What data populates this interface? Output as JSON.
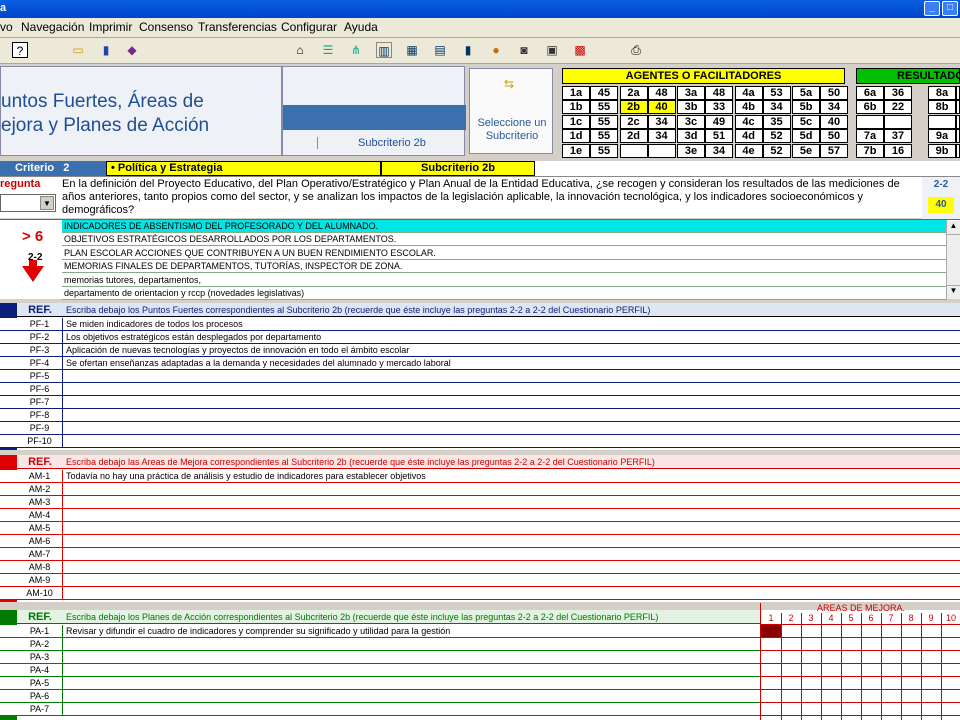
{
  "window": {
    "title": "a"
  },
  "menu": [
    "vo",
    "Navegación",
    "Imprimir",
    "Consenso",
    "Transferencias",
    "Configurar",
    "Ayuda"
  ],
  "header": {
    "title_line1": "untos Fuertes, Áreas de",
    "title_line2": "ejora y Planes de Acción",
    "subcriterio_label": "Subcriterio 2b",
    "select_hint": "Seleccione un Subcriterio"
  },
  "agentes": {
    "title": "AGENTES O FACILITADORES",
    "rows": [
      [
        [
          "1a",
          "45"
        ],
        [
          "2a",
          "48"
        ],
        [
          "3a",
          "48"
        ],
        [
          "4a",
          "53"
        ],
        [
          "5a",
          "50"
        ]
      ],
      [
        [
          "1b",
          "55"
        ],
        [
          "2b",
          "40"
        ],
        [
          "3b",
          "33"
        ],
        [
          "4b",
          "34"
        ],
        [
          "5b",
          "34"
        ]
      ],
      [
        [
          "1c",
          "55"
        ],
        [
          "2c",
          "34"
        ],
        [
          "3c",
          "49"
        ],
        [
          "4c",
          "35"
        ],
        [
          "5c",
          "40"
        ]
      ],
      [
        [
          "1d",
          "55"
        ],
        [
          "2d",
          "34"
        ],
        [
          "3d",
          "51"
        ],
        [
          "4d",
          "52"
        ],
        [
          "5d",
          "50"
        ]
      ],
      [
        [
          "1e",
          "55"
        ],
        [
          "",
          ""
        ],
        [
          "3e",
          "34"
        ],
        [
          "4e",
          "52"
        ],
        [
          "5e",
          "57"
        ]
      ]
    ]
  },
  "resultados": {
    "title": "RESULTADOS",
    "rows": [
      [
        [
          "6a",
          "36"
        ],
        [
          "8a",
          ""
        ]
      ],
      [
        [
          "6b",
          "22"
        ],
        [
          "8b",
          ""
        ]
      ],
      [
        [
          "",
          ""
        ],
        [
          "",
          ""
        ]
      ],
      [
        [
          "7a",
          "37"
        ],
        [
          "9a",
          ""
        ]
      ],
      [
        [
          "7b",
          "16"
        ],
        [
          "9b",
          ""
        ]
      ]
    ]
  },
  "criterio": {
    "label": "Criterio",
    "number": "2",
    "name": "• Política y Estrategia",
    "sub": "Subcriterio 2b"
  },
  "pregunta": {
    "label": "regunta",
    "text": "En la definición del Proyecto Educativo, del Plan Operativo/Estratégico y Plan Anual de la Entidad Educativa, ¿se recogen y consideran los resultados de las mediciones de años anteriores, tanto propios como del sector, y se analizan los impactos de la legislación aplicable, la innovación tecnológica, y los indicadores socioeconómicos y demográficos?",
    "code": "2-2",
    "score": "40"
  },
  "evidence": {
    "badge": "> 6",
    "code": "2-2",
    "items": [
      "INDICADORES DE ABSENTISMO DEL PROFESORADO Y DEL ALUMNADO.",
      "OBJETIVOS ESTRATÉGICOS DESARROLLADOS POR LOS DEPARTAMENTOS.",
      "PLAN ESCOLAR ACCIONES QUE CONTRIBUYEN A UN BUEN RENDIMIENTO ESCOLAR.",
      "MEMORIAS FINALES DE DEPARTAMENTOS, TUTORÍAS, INSPECTOR DE ZONA.",
      "memorias tutores, departamentos,",
      "departamento de orientacion y rccp (novedades legislativas)"
    ]
  },
  "pf": {
    "ref": "REF.",
    "header": "Escriba debajo los Puntos Fuertes correspondientes al Subcriterio 2b (recuerde que éste incluye las preguntas 2-2 a 2-2 del Cuestionario PERFIL)",
    "rows": [
      [
        "PF-1",
        "Se miden indicadores de todos los procesos"
      ],
      [
        "PF-2",
        "Los objetivos estratégicos están desplegados por departamento"
      ],
      [
        "PF-3",
        "Aplicación de nuevas tecnologías y proyectos de innovación en todo el ámbito escolar"
      ],
      [
        "PF-4",
        "Se ofertan enseñanzas adaptadas a la demanda y necesidades del alumnado y mercado laboral"
      ],
      [
        "PF-5",
        ""
      ],
      [
        "PF-6",
        ""
      ],
      [
        "PF-7",
        ""
      ],
      [
        "PF-8",
        ""
      ],
      [
        "PF-9",
        ""
      ],
      [
        "PF-10",
        ""
      ]
    ]
  },
  "am": {
    "ref": "REF.",
    "header": "Escriba debajo las Areas de Mejora correspondientes al Subcriterio 2b (recuerde que éste incluye las preguntas 2-2 a 2-2 del Cuestionario PERFIL)",
    "rows": [
      [
        "AM-1",
        "Todavía no hay una práctica de análisis y estudio de indicadores para establecer objetivos"
      ],
      [
        "AM-2",
        ""
      ],
      [
        "AM-3",
        ""
      ],
      [
        "AM-4",
        ""
      ],
      [
        "AM-5",
        ""
      ],
      [
        "AM-6",
        ""
      ],
      [
        "AM-7",
        ""
      ],
      [
        "AM-8",
        ""
      ],
      [
        "AM-9",
        ""
      ],
      [
        "AM-10",
        ""
      ]
    ]
  },
  "pa": {
    "ref": "REF.",
    "header": "Escriba debajo los Planes de Acción correspondientes al Subcriterio 2b (recuerde que éste incluye las preguntas 2-2 a 2-2 del Cuestionario PERFIL)",
    "rows": [
      [
        "PA-1",
        "Revisar y difundir el cuadro de indicadores y comprender su significado y utilidad para la gestión"
      ],
      [
        "PA-2",
        ""
      ],
      [
        "PA-3",
        ""
      ],
      [
        "PA-4",
        ""
      ],
      [
        "PA-5",
        ""
      ],
      [
        "PA-6",
        ""
      ],
      [
        "PA-7",
        ""
      ]
    ],
    "areas_title": "AREAS DE MEJORA.",
    "areas_cols": [
      "1",
      "2",
      "3",
      "4",
      "5",
      "6",
      "7",
      "8",
      "9",
      "10"
    ]
  },
  "colors": {
    "blue": "#0a1e7a",
    "red": "#e00000",
    "green": "#007a00",
    "yellow": "#ffff00",
    "accent_green": "#00c000"
  }
}
